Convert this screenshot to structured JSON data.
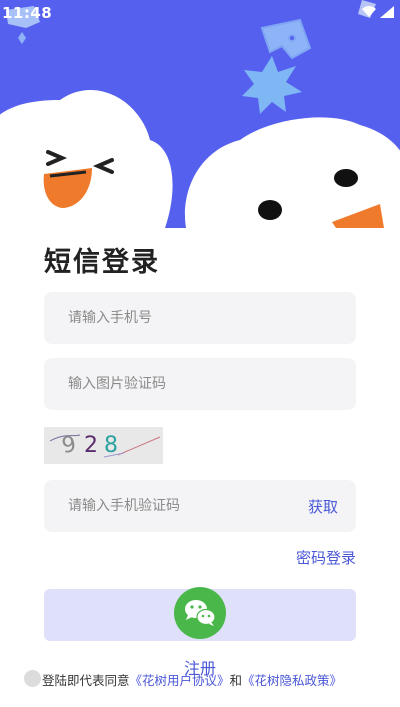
{
  "status_bar": {
    "time": "11:48"
  },
  "page": {
    "title": "短信登录"
  },
  "form": {
    "phone_placeholder": "请输入手机号",
    "image_code_placeholder": "输入图片验证码",
    "captcha_digits": [
      "9",
      "2",
      "8"
    ],
    "sms_code_placeholder": "请输入手机验证码",
    "get_code_label": "获取"
  },
  "links": {
    "password_login": "密码登录",
    "register": "注册"
  },
  "agreement": {
    "prefix": "登陆即代表同意",
    "user_agreement": "《花树用户协议》",
    "and": "和",
    "privacy_policy": "《花树隐私政策》"
  },
  "colors": {
    "header_bg": "#5561ee",
    "link": "#4a57d6",
    "field_bg": "#f4f4f6",
    "login_button_bg": "#dfe1fb",
    "wechat_green": "#4ab74a",
    "mascot_beak": "#f07a2c"
  },
  "icons": {
    "wechat": "wechat-icon",
    "checkbox": "agree-checkbox-icon",
    "wifi": "wifi-icon",
    "signal": "signal-icon"
  }
}
